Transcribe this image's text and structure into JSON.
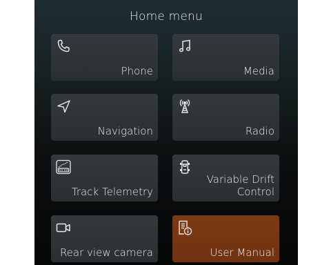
{
  "header": {
    "title": "Home menu"
  },
  "tiles": [
    {
      "label": "Phone",
      "icon": "phone-icon"
    },
    {
      "label": "Media",
      "icon": "music-note-icon"
    },
    {
      "label": "Navigation",
      "icon": "navigation-arrow-icon"
    },
    {
      "label": "Radio",
      "icon": "radio-tower-icon"
    },
    {
      "label": "Track Telemetry",
      "icon": "telemetry-gauge-icon"
    },
    {
      "label": "Variable Drift Control",
      "icon": "car-top-view-icon"
    },
    {
      "label": "Rear view camera",
      "icon": "camera-icon"
    },
    {
      "label": "User Manual",
      "icon": "manual-info-icon"
    }
  ],
  "colors": {
    "tile": "#2e3336",
    "accent_tile": "#773710",
    "text": "#e6e9ea"
  }
}
